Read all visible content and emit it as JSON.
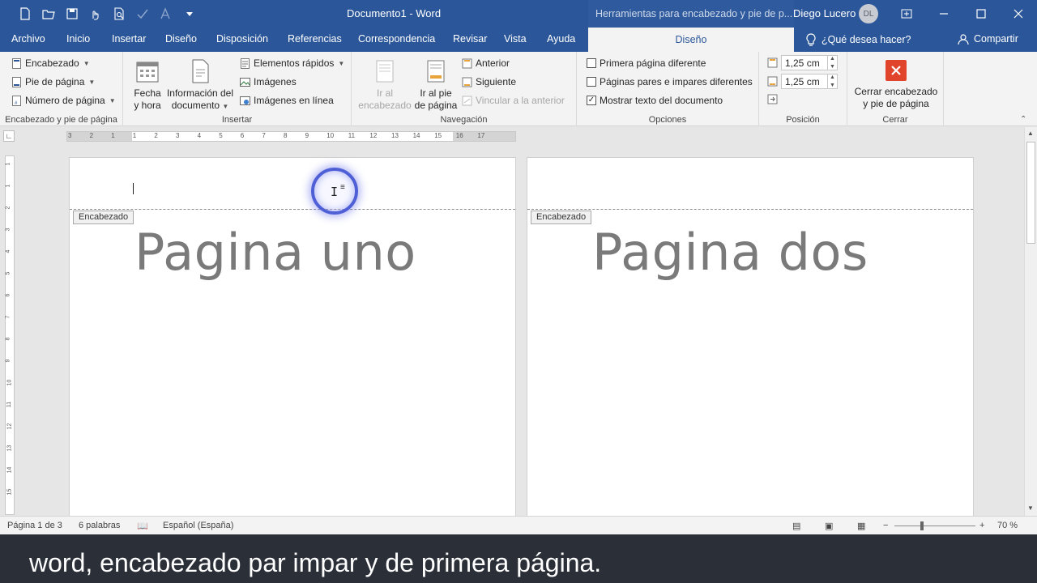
{
  "window": {
    "doc_title": "Documento1  -  Word",
    "context_title": "Herramientas para encabezado y pie de p...",
    "user_name": "Diego Lucero",
    "user_initials": "DL"
  },
  "tabs": [
    "Archivo",
    "Inicio",
    "Insertar",
    "Diseño",
    "Disposición",
    "Referencias",
    "Correspondencia",
    "Revisar",
    "Vista",
    "Ayuda"
  ],
  "active_context_tab": "Diseño",
  "tell_me": "¿Qué desea hacer?",
  "share": "Compartir",
  "ribbon": {
    "group1": {
      "label": "Encabezado y pie de página",
      "items": [
        "Encabezado",
        "Pie de página",
        "Número de página"
      ]
    },
    "group2": {
      "label": "Insertar",
      "fecha": [
        "Fecha",
        "y hora"
      ],
      "info": [
        "Información del",
        "documento"
      ],
      "small": [
        "Elementos rápidos",
        "Imágenes",
        "Imágenes en línea"
      ]
    },
    "group3": {
      "label": "Navegación",
      "ir_encabezado": [
        "Ir al",
        "encabezado"
      ],
      "ir_pie": [
        "Ir al pie",
        "de página"
      ],
      "small": [
        "Anterior",
        "Siguiente",
        "Vincular a la anterior"
      ]
    },
    "group4": {
      "label": "Opciones",
      "checks": [
        {
          "label": "Primera página diferente",
          "checked": false
        },
        {
          "label": "Páginas pares e impares diferentes",
          "checked": false
        },
        {
          "label": "Mostrar texto del documento",
          "checked": true
        }
      ]
    },
    "group5": {
      "label": "Posición",
      "top": "1,25 cm",
      "bottom": "1,25 cm"
    },
    "group6": {
      "label": "Cerrar",
      "close": [
        "Cerrar encabezado",
        "y pie de página"
      ]
    }
  },
  "ruler_numbers": [
    "3",
    "2",
    "1",
    "1",
    "2",
    "3",
    "4",
    "5",
    "6",
    "7",
    "8",
    "9",
    "10",
    "11",
    "12",
    "13",
    "14",
    "15",
    "16",
    "17"
  ],
  "vruler_numbers": [
    "1",
    "1",
    "2",
    "3",
    "4",
    "5",
    "6",
    "7",
    "8",
    "9",
    "10",
    "11",
    "12",
    "13",
    "14",
    "15"
  ],
  "pages": [
    {
      "header_tag": "Encabezado",
      "text": "Pagina uno"
    },
    {
      "header_tag": "Encabezado",
      "text": "Pagina dos"
    }
  ],
  "status": {
    "page": "Página 1 de 3",
    "words": "6 palabras",
    "language": "Español (España)",
    "zoom": "70 %"
  },
  "caption": "word, encabezado par impar y de primera página.",
  "colors": {
    "accent": "#2b579a",
    "close_red": "#e0442a"
  }
}
